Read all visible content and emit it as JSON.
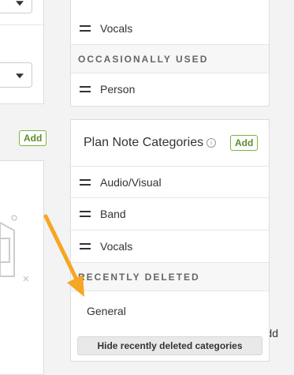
{
  "left": {
    "add_label": "Add",
    "empty_text": "o add"
  },
  "top_card": {
    "rows": [
      {
        "label": "Vocals"
      }
    ],
    "section_header": "OCCASIONALLY USED",
    "occasional_rows": [
      {
        "label": "Person"
      }
    ]
  },
  "plan_note_card": {
    "title": "Plan Note Categories",
    "info_icon": "info-icon",
    "add_label": "Add",
    "rows": [
      {
        "label": "Audio/Visual"
      },
      {
        "label": "Band"
      },
      {
        "label": "Vocals"
      }
    ],
    "deleted_header": "RECENTLY DELETED",
    "deleted_rows": [
      {
        "label": "General"
      }
    ],
    "hide_button_label": "Hide recently deleted categories"
  },
  "colors": {
    "add_green": "#7cb342",
    "annotation_arrow": "#f6a623"
  }
}
